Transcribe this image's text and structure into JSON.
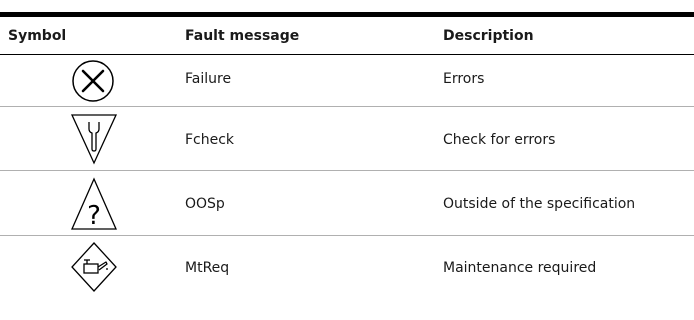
{
  "table": {
    "headers": {
      "symbol": "Symbol",
      "fault_message": "Fault message",
      "description": "Description"
    },
    "rows": [
      {
        "icon": "failure-x-circle-icon",
        "fault_message": "Failure",
        "description": "Errors"
      },
      {
        "icon": "check-function-wrench-triangle-icon",
        "fault_message": "Fcheck",
        "description": "Check for errors"
      },
      {
        "icon": "out-of-specification-question-triangle-icon",
        "fault_message": "OOSp",
        "description": "Outside of the specification"
      },
      {
        "icon": "maintenance-oilcan-diamond-icon",
        "fault_message": "MtReq",
        "description": "Maintenance required"
      }
    ]
  },
  "colors": {
    "rule": "#000000",
    "separator": "#b0b0b0",
    "text": "#1a1a1a"
  }
}
